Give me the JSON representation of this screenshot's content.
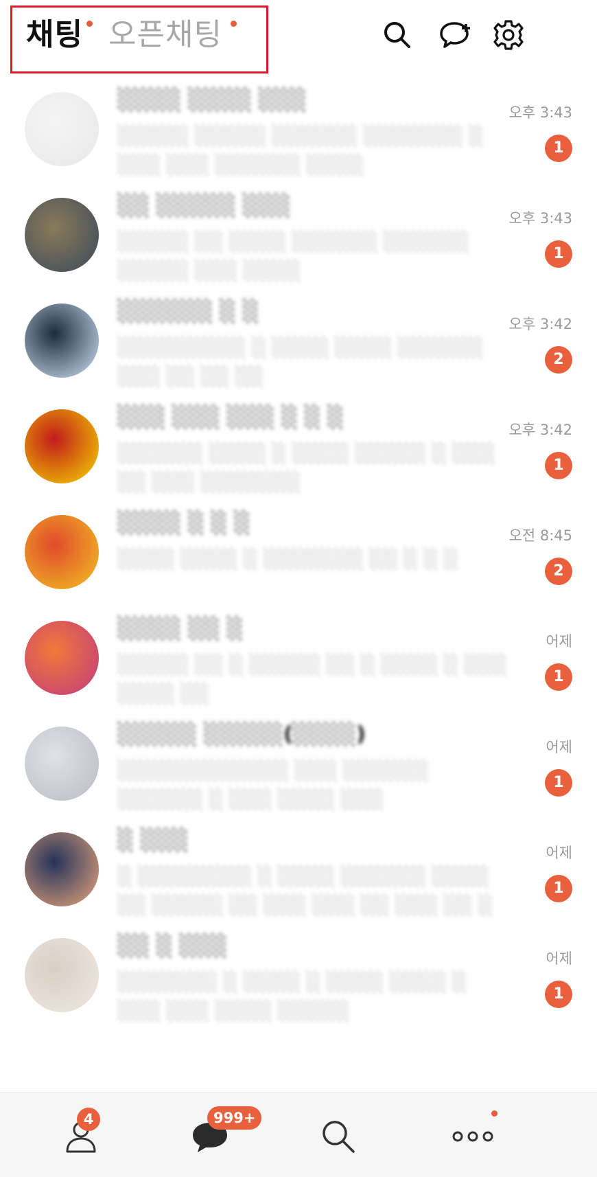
{
  "header": {
    "tabs": [
      {
        "label": "채팅",
        "active": true,
        "has_dot": true
      },
      {
        "label": "오픈채팅",
        "active": false,
        "has_dot": true
      }
    ],
    "icons": [
      "search-icon",
      "new-chat-icon",
      "settings-icon"
    ]
  },
  "chats": [
    {
      "name": "░░░░ ░░░░ ░░░",
      "preview": "░░░░░ ░░░░░ ░░░░░░ ░░░░░░░ ░ ░░░ ░░░ ░░░░░░ ░░░░",
      "time": "오후 3:43",
      "unread": "1",
      "avatar_colors": [
        "#e8e8e8",
        "#f4f4f4"
      ]
    },
    {
      "name": "░░ ░░░░░ ░░░",
      "preview": "░░░░░ ░░ ░░░░ ░░░░░░ ░░░░░░ ░░░░░ ░░░ ░░░░",
      "time": "오후 3:43",
      "unread": "1",
      "avatar_colors": [
        "#3a4a5a",
        "#8a7a5a"
      ]
    },
    {
      "name": "░░░░░░ ░ ░",
      "preview": "░░░░░░░░░ ░ ░░░░ ░░░░ ░░░░░░ ░░░ ░░ ░░ ░░",
      "time": "오후 3:42",
      "unread": "2",
      "avatar_colors": [
        "#cfe3f5",
        "#1e2b3c"
      ]
    },
    {
      "name": "░░░ ░░░ ░░░ ░ ░ ░",
      "preview": "░░░░░░ ░░░░ ░ ░░░░ ░░░░░ ░ ░░░ ░░ ░░░ ░░░░░░░",
      "time": "오후 3:42",
      "unread": "1",
      "avatar_colors": [
        "#f5d800",
        "#c21b1b"
      ]
    },
    {
      "name": "░░░░ ░ ░ ░",
      "preview": "░░░░ ░░░░ ░ ░░░░░░░ ░░ ░ ░ ░",
      "time": "오전 8:45",
      "unread": "2",
      "avatar_colors": [
        "#f3c322",
        "#e04a2c"
      ]
    },
    {
      "name": "░░░░ ░░ ░",
      "preview": "░░░░░ ░░ ░ ░░░░░ ░░ ░ ░░░░ ░ ░░░ ░░░░ ░░",
      "time": "어제",
      "unread": "1",
      "avatar_colors": [
        "#c23a7d",
        "#f07a3a"
      ]
    },
    {
      "name": "░░░░░ ░░░░░(░░░░)",
      "preview": "░░░░░░░░░░░░ ░░░ ░░░░░░ ░░░░░░ ░ ░░░ ░░░░ ░░░",
      "time": "어제",
      "unread": "1",
      "avatar_colors": [
        "#b8bcc2",
        "#dfe2e6"
      ]
    },
    {
      "name": "░ ░░░",
      "preview": "░ ░░░░░░░░ ░ ░░░░ ░░░░░░ ░░░░ ░░ ░░░░░ ░░ ░░░ ░░░ ░░ ░░░ ░░ ░",
      "time": "어제",
      "unread": "1",
      "avatar_colors": [
        "#e8a77c",
        "#26335a"
      ]
    },
    {
      "name": "░░ ░ ░░░",
      "preview": "░░░░░░░ ░ ░░░░ ░ ░░░░ ░░░░ ░ ░░░ ░░░ ░░░░ ░░░░░",
      "time": "어제",
      "unread": "1",
      "avatar_colors": [
        "#efe9e3",
        "#d8cfc4"
      ]
    }
  ],
  "bottom_nav": {
    "items": [
      {
        "name": "friends",
        "icon": "person-icon",
        "badge": "4"
      },
      {
        "name": "chats",
        "icon": "chat-bubble-icon",
        "badge": "999+"
      },
      {
        "name": "view",
        "icon": "search-icon",
        "badge": ""
      },
      {
        "name": "more",
        "icon": "more-icon",
        "badge": "",
        "has_dot": true
      }
    ]
  },
  "colors": {
    "accent": "#e8603c",
    "highlight_border": "#e0192b"
  }
}
